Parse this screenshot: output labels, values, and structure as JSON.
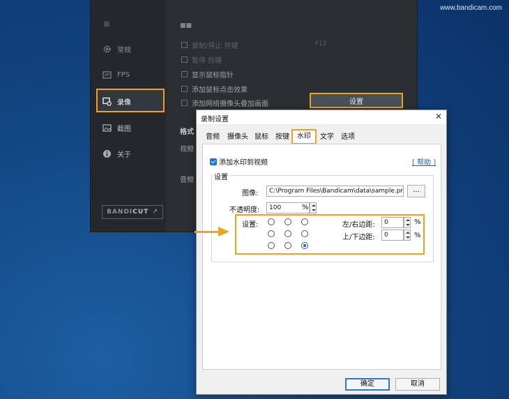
{
  "watermark": "www.bandicam.com",
  "main_window": {
    "sidebar": {
      "items": [
        {
          "label": "常规",
          "icon": "gear-icon",
          "state": "dim"
        },
        {
          "label": "FPS",
          "icon": "fps-icon",
          "state": "dim"
        },
        {
          "label": "录像",
          "icon": "video-settings-icon",
          "state": "selected"
        },
        {
          "label": "截图",
          "icon": "image-icon",
          "state": "normal"
        },
        {
          "label": "关于",
          "icon": "info-icon",
          "state": "normal"
        }
      ],
      "brand": {
        "prefix": "BANDI",
        "suffix": "CUT"
      }
    },
    "content": {
      "options": [
        {
          "label": "录制/停止 热键",
          "hotkey": "F12"
        },
        {
          "label": "暂停 热键"
        },
        {
          "label": "显示鼠标指针"
        },
        {
          "label": "添加鼠标点击效果"
        },
        {
          "label": "添加网络摄像头叠加画面"
        }
      ],
      "settings_button": "设置",
      "format_label": "格式",
      "video_label": "视频",
      "audio_label": "音频"
    }
  },
  "dialog": {
    "title": "录制设置",
    "tabs": [
      "音频",
      "摄像头",
      "鼠标",
      "按键",
      "水印",
      "文字",
      "选项"
    ],
    "active_tab": "水印",
    "add_watermark_label": "添加水印到视频",
    "help_link": "[ 帮助 ]",
    "group_title": "设置",
    "image_label": "图像:",
    "image_path": "C:\\Program Files\\Bandicam\\data\\sample.png",
    "browse_button": "...",
    "opacity_label": "不透明度:",
    "opacity_value": "100",
    "opacity_unit": "%",
    "position_label": "设置:",
    "position_selected_index": 8,
    "lr_margin_label": "左/右边距:",
    "lr_margin_value": "0",
    "tb_margin_label": "上/下边距:",
    "tb_margin_value": "0",
    "margin_unit": "%",
    "ok_button": "确定",
    "cancel_button": "取消"
  },
  "colors": {
    "highlight": "#f0a11e",
    "accent_blue": "#1e73d2"
  }
}
